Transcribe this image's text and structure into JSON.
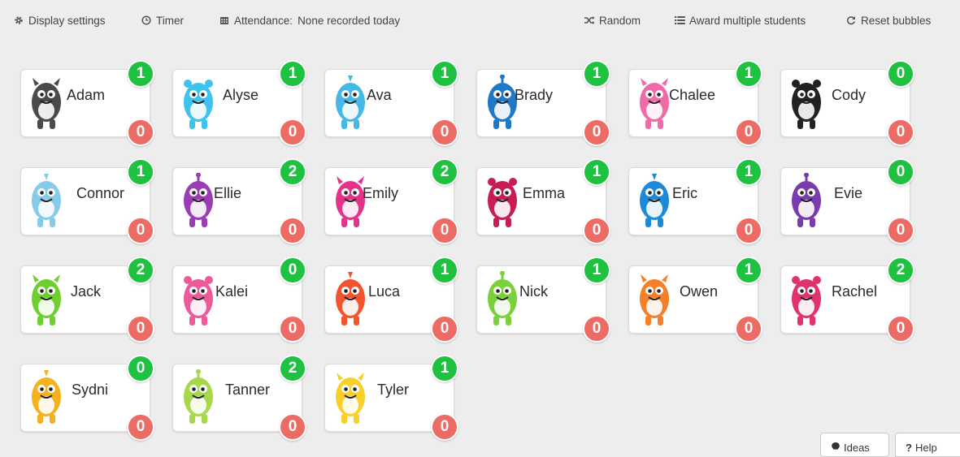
{
  "toolbar": {
    "display_settings": "Display settings",
    "timer": "Timer",
    "attendance_label": "Attendance:",
    "attendance_value": "None recorded today",
    "random": "Random",
    "award_multiple": "Award multiple students",
    "reset_bubbles": "Reset bubbles"
  },
  "students": [
    {
      "name": "Adam",
      "positive": "1",
      "negative": "0",
      "monster": "gray-monster-icon",
      "color": "#4a4a4a"
    },
    {
      "name": "Alyse",
      "positive": "1",
      "negative": "0",
      "monster": "light-blue-furry-monster-icon",
      "color": "#3fc3ee"
    },
    {
      "name": "Ava",
      "positive": "1",
      "negative": "0",
      "monster": "blue-spiky-monster-icon",
      "color": "#45b8e6"
    },
    {
      "name": "Brady",
      "positive": "1",
      "negative": "0",
      "monster": "blue-monster-icon",
      "color": "#1f78c8"
    },
    {
      "name": "Chalee",
      "positive": "1",
      "negative": "0",
      "monster": "pink-monster-icon",
      "color": "#f06aa8"
    },
    {
      "name": "Cody",
      "positive": "0",
      "negative": "0",
      "monster": "black-white-monster-icon",
      "color": "#222222"
    },
    {
      "name": "Connor",
      "positive": "1",
      "negative": "0",
      "monster": "many-eyed-monster-icon",
      "color": "#86cbe8"
    },
    {
      "name": "Ellie",
      "positive": "2",
      "negative": "0",
      "monster": "purple-cat-monster-icon",
      "color": "#9b3db5"
    },
    {
      "name": "Emily",
      "positive": "2",
      "negative": "0",
      "monster": "magenta-monster-icon",
      "color": "#e5338c"
    },
    {
      "name": "Emma",
      "positive": "1",
      "negative": "0",
      "monster": "crimson-monster-icon",
      "color": "#c81d52"
    },
    {
      "name": "Eric",
      "positive": "1",
      "negative": "0",
      "monster": "blue-horned-monster-icon",
      "color": "#1d8ad8"
    },
    {
      "name": "Evie",
      "positive": "0",
      "negative": "0",
      "monster": "purple-furry-monster-icon",
      "color": "#7a3cad"
    },
    {
      "name": "Jack",
      "positive": "2",
      "negative": "0",
      "monster": "green-horned-monster-icon",
      "color": "#6fcf2f"
    },
    {
      "name": "Kalei",
      "positive": "0",
      "negative": "0",
      "monster": "pink-cyclops-monster-icon",
      "color": "#ec5a9a"
    },
    {
      "name": "Luca",
      "positive": "1",
      "negative": "0",
      "monster": "orange-red-monster-icon",
      "color": "#f2542d"
    },
    {
      "name": "Nick",
      "positive": "1",
      "negative": "0",
      "monster": "green-antenna-monster-icon",
      "color": "#7bd13b"
    },
    {
      "name": "Owen",
      "positive": "1",
      "negative": "0",
      "monster": "orange-furry-monster-icon",
      "color": "#f4812a"
    },
    {
      "name": "Rachel",
      "positive": "2",
      "negative": "0",
      "monster": "pink-red-monster-icon",
      "color": "#e0336b"
    },
    {
      "name": "Sydni",
      "positive": "0",
      "negative": "0",
      "monster": "yellow-octopus-monster-icon",
      "color": "#f5b21e"
    },
    {
      "name": "Tanner",
      "positive": "2",
      "negative": "0",
      "monster": "lime-spotted-monster-icon",
      "color": "#a6d84a"
    },
    {
      "name": "Tyler",
      "positive": "1",
      "negative": "0",
      "monster": "yellow-black-bear-monster-icon",
      "color": "#f7d02a"
    }
  ],
  "footer": {
    "ideas": "Ideas",
    "help": "Help"
  },
  "colors": {
    "positive_bubble": "#1fc140",
    "negative_bubble": "#ec6b64",
    "background": "#ededed"
  }
}
